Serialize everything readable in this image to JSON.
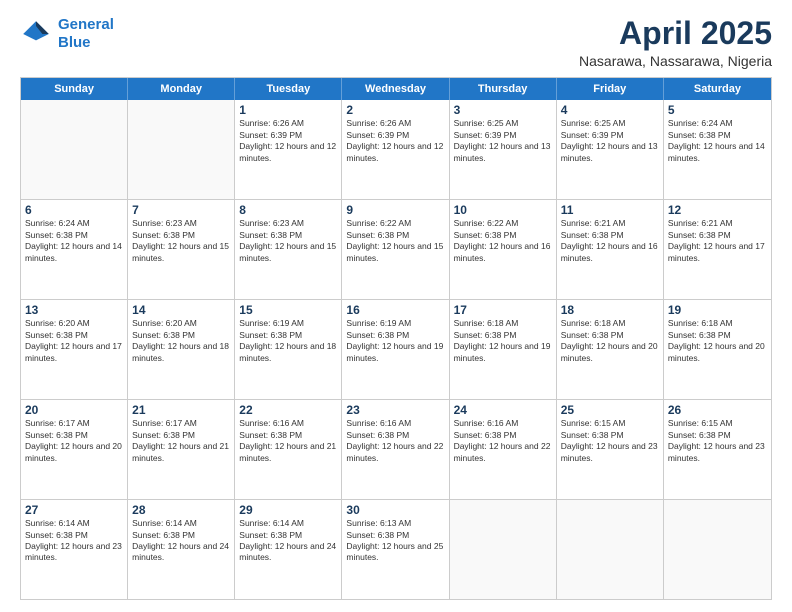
{
  "logo": {
    "line1": "General",
    "line2": "Blue"
  },
  "title": "April 2025",
  "subtitle": "Nasarawa, Nassarawa, Nigeria",
  "headers": [
    "Sunday",
    "Monday",
    "Tuesday",
    "Wednesday",
    "Thursday",
    "Friday",
    "Saturday"
  ],
  "weeks": [
    [
      {
        "day": "",
        "info": ""
      },
      {
        "day": "",
        "info": ""
      },
      {
        "day": "1",
        "info": "Sunrise: 6:26 AM\nSunset: 6:39 PM\nDaylight: 12 hours and 12 minutes."
      },
      {
        "day": "2",
        "info": "Sunrise: 6:26 AM\nSunset: 6:39 PM\nDaylight: 12 hours and 12 minutes."
      },
      {
        "day": "3",
        "info": "Sunrise: 6:25 AM\nSunset: 6:39 PM\nDaylight: 12 hours and 13 minutes."
      },
      {
        "day": "4",
        "info": "Sunrise: 6:25 AM\nSunset: 6:39 PM\nDaylight: 12 hours and 13 minutes."
      },
      {
        "day": "5",
        "info": "Sunrise: 6:24 AM\nSunset: 6:38 PM\nDaylight: 12 hours and 14 minutes."
      }
    ],
    [
      {
        "day": "6",
        "info": "Sunrise: 6:24 AM\nSunset: 6:38 PM\nDaylight: 12 hours and 14 minutes."
      },
      {
        "day": "7",
        "info": "Sunrise: 6:23 AM\nSunset: 6:38 PM\nDaylight: 12 hours and 15 minutes."
      },
      {
        "day": "8",
        "info": "Sunrise: 6:23 AM\nSunset: 6:38 PM\nDaylight: 12 hours and 15 minutes."
      },
      {
        "day": "9",
        "info": "Sunrise: 6:22 AM\nSunset: 6:38 PM\nDaylight: 12 hours and 15 minutes."
      },
      {
        "day": "10",
        "info": "Sunrise: 6:22 AM\nSunset: 6:38 PM\nDaylight: 12 hours and 16 minutes."
      },
      {
        "day": "11",
        "info": "Sunrise: 6:21 AM\nSunset: 6:38 PM\nDaylight: 12 hours and 16 minutes."
      },
      {
        "day": "12",
        "info": "Sunrise: 6:21 AM\nSunset: 6:38 PM\nDaylight: 12 hours and 17 minutes."
      }
    ],
    [
      {
        "day": "13",
        "info": "Sunrise: 6:20 AM\nSunset: 6:38 PM\nDaylight: 12 hours and 17 minutes."
      },
      {
        "day": "14",
        "info": "Sunrise: 6:20 AM\nSunset: 6:38 PM\nDaylight: 12 hours and 18 minutes."
      },
      {
        "day": "15",
        "info": "Sunrise: 6:19 AM\nSunset: 6:38 PM\nDaylight: 12 hours and 18 minutes."
      },
      {
        "day": "16",
        "info": "Sunrise: 6:19 AM\nSunset: 6:38 PM\nDaylight: 12 hours and 19 minutes."
      },
      {
        "day": "17",
        "info": "Sunrise: 6:18 AM\nSunset: 6:38 PM\nDaylight: 12 hours and 19 minutes."
      },
      {
        "day": "18",
        "info": "Sunrise: 6:18 AM\nSunset: 6:38 PM\nDaylight: 12 hours and 20 minutes."
      },
      {
        "day": "19",
        "info": "Sunrise: 6:18 AM\nSunset: 6:38 PM\nDaylight: 12 hours and 20 minutes."
      }
    ],
    [
      {
        "day": "20",
        "info": "Sunrise: 6:17 AM\nSunset: 6:38 PM\nDaylight: 12 hours and 20 minutes."
      },
      {
        "day": "21",
        "info": "Sunrise: 6:17 AM\nSunset: 6:38 PM\nDaylight: 12 hours and 21 minutes."
      },
      {
        "day": "22",
        "info": "Sunrise: 6:16 AM\nSunset: 6:38 PM\nDaylight: 12 hours and 21 minutes."
      },
      {
        "day": "23",
        "info": "Sunrise: 6:16 AM\nSunset: 6:38 PM\nDaylight: 12 hours and 22 minutes."
      },
      {
        "day": "24",
        "info": "Sunrise: 6:16 AM\nSunset: 6:38 PM\nDaylight: 12 hours and 22 minutes."
      },
      {
        "day": "25",
        "info": "Sunrise: 6:15 AM\nSunset: 6:38 PM\nDaylight: 12 hours and 23 minutes."
      },
      {
        "day": "26",
        "info": "Sunrise: 6:15 AM\nSunset: 6:38 PM\nDaylight: 12 hours and 23 minutes."
      }
    ],
    [
      {
        "day": "27",
        "info": "Sunrise: 6:14 AM\nSunset: 6:38 PM\nDaylight: 12 hours and 23 minutes."
      },
      {
        "day": "28",
        "info": "Sunrise: 6:14 AM\nSunset: 6:38 PM\nDaylight: 12 hours and 24 minutes."
      },
      {
        "day": "29",
        "info": "Sunrise: 6:14 AM\nSunset: 6:38 PM\nDaylight: 12 hours and 24 minutes."
      },
      {
        "day": "30",
        "info": "Sunrise: 6:13 AM\nSunset: 6:38 PM\nDaylight: 12 hours and 25 minutes."
      },
      {
        "day": "",
        "info": ""
      },
      {
        "day": "",
        "info": ""
      },
      {
        "day": "",
        "info": ""
      }
    ]
  ]
}
